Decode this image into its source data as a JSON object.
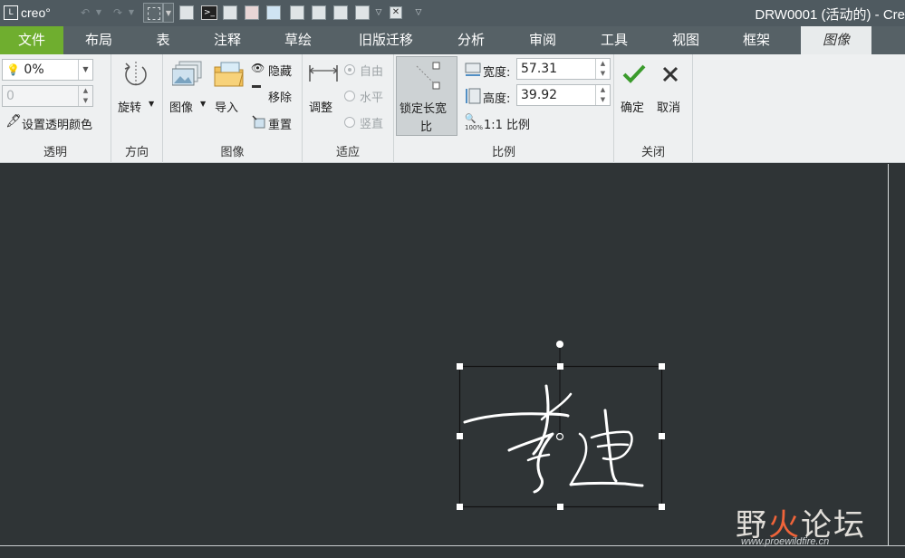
{
  "titlebar": {
    "logo_box": "L",
    "logo_text": "creo°",
    "window_title": "DRW0001 (活动的) - Cre"
  },
  "tabs": [
    "文件",
    "布局",
    "表",
    "注释",
    "草绘",
    "旧版迁移",
    "分析",
    "审阅",
    "工具",
    "视图",
    "框架",
    "图像"
  ],
  "ribbon": {
    "transparency": {
      "value": "0%",
      "second_value": "0",
      "set_color": "设置透明颜色",
      "group_label": "透明"
    },
    "orientation": {
      "rotate": "旋转",
      "group_label": "方向"
    },
    "image": {
      "image_btn": "图像",
      "import_btn": "导入",
      "hide": "隐藏",
      "remove": "移除",
      "reset": "重置",
      "group_label": "图像"
    },
    "fit": {
      "adjust": "调整",
      "free": "自由",
      "horizontal": "水平",
      "vertical": "竖直",
      "group_label": "适应"
    },
    "scale": {
      "lock_line1": "锁定长宽",
      "lock_line2": "比",
      "width_label": "宽度:",
      "width_value": "57.31",
      "height_label": "高度:",
      "height_value": "39.92",
      "one_to_one": "1:1 比例",
      "one_to_one_badge": "100%",
      "group_label": "比例"
    },
    "close": {
      "ok": "确定",
      "cancel": "取消",
      "group_label": "关闭"
    }
  },
  "watermark": {
    "title_a": "野",
    "title_fire": "火",
    "title_b": "论坛",
    "url": "www.proewildfire.cn"
  },
  "colors": {
    "file_tab": "#6fae2f",
    "canvas": "#2f3436",
    "titlebar": "#4f5a60",
    "ok_check": "#3a9b2c"
  }
}
